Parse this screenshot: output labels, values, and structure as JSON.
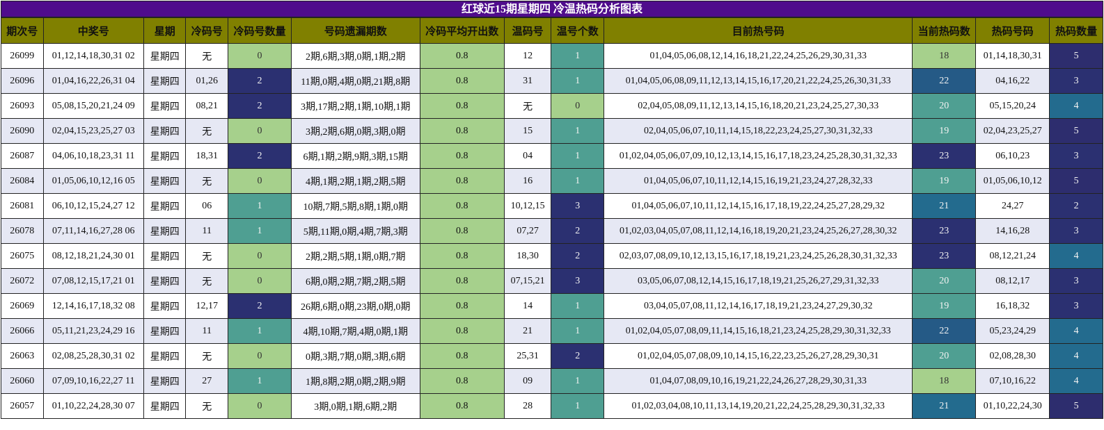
{
  "title": "红球近15期星期四 冷温热码分析图表",
  "headers": [
    "期次号",
    "中奖号",
    "星期",
    "冷码号",
    "冷码号数量",
    "号码遗漏期数",
    "冷码平均开出数",
    "温码号",
    "温号个数",
    "目前热号码",
    "当前热码数",
    "热码号码",
    "热码数量"
  ],
  "colors": {
    "title_bg": "#4f0c8c",
    "header_bg": "#808000",
    "row_alt": "#e6e8f4",
    "scale": {
      "0": "#a6d08c",
      "1": "#4f9f92",
      "2": "#2b3071",
      "3": "#2b3071",
      "4": "#236b8e",
      "5": "#2d2d6e"
    }
  },
  "rows": [
    {
      "issue": "26099",
      "numbers": "01,12,14,18,30,31 02",
      "weekday": "星期四",
      "cold": "无",
      "cold_count": "0",
      "miss": "2期,6期,3期,0期,1期,2期",
      "cold_avg": "0.8",
      "warm": "12",
      "warm_count": "1",
      "hot": "01,04,05,06,08,12,14,16,18,21,22,24,25,26,29,30,31,33",
      "hot_count": "18",
      "hot_hit": "01,14,18,30,31",
      "hot_hit_count": "5"
    },
    {
      "issue": "26096",
      "numbers": "01,04,16,22,26,31 04",
      "weekday": "星期四",
      "cold": "01,26",
      "cold_count": "2",
      "miss": "11期,0期,4期,0期,21期,8期",
      "cold_avg": "0.8",
      "warm": "31",
      "warm_count": "1",
      "hot": "01,04,05,06,08,09,11,12,13,14,15,16,17,20,21,22,24,25,26,30,31,33",
      "hot_count": "22",
      "hot_hit": "04,16,22",
      "hot_hit_count": "3"
    },
    {
      "issue": "26093",
      "numbers": "05,08,15,20,21,24 09",
      "weekday": "星期四",
      "cold": "08,21",
      "cold_count": "2",
      "miss": "3期,17期,2期,1期,10期,1期",
      "cold_avg": "0.8",
      "warm": "无",
      "warm_count": "0",
      "hot": "02,04,05,08,09,11,12,13,14,15,16,18,20,21,23,24,25,27,30,33",
      "hot_count": "20",
      "hot_hit": "05,15,20,24",
      "hot_hit_count": "4"
    },
    {
      "issue": "26090",
      "numbers": "02,04,15,23,25,27 03",
      "weekday": "星期四",
      "cold": "无",
      "cold_count": "0",
      "miss": "3期,2期,6期,0期,3期,0期",
      "cold_avg": "0.8",
      "warm": "15",
      "warm_count": "1",
      "hot": "02,04,05,06,07,10,11,14,15,18,22,23,24,25,27,30,31,32,33",
      "hot_count": "19",
      "hot_hit": "02,04,23,25,27",
      "hot_hit_count": "5"
    },
    {
      "issue": "26087",
      "numbers": "04,06,10,18,23,31 11",
      "weekday": "星期四",
      "cold": "18,31",
      "cold_count": "2",
      "miss": "6期,1期,2期,9期,3期,15期",
      "cold_avg": "0.8",
      "warm": "04",
      "warm_count": "1",
      "hot": "01,02,04,05,06,07,09,10,12,13,14,15,16,17,18,23,24,25,28,30,31,32,33",
      "hot_count": "23",
      "hot_hit": "06,10,23",
      "hot_hit_count": "3"
    },
    {
      "issue": "26084",
      "numbers": "01,05,06,10,12,16 05",
      "weekday": "星期四",
      "cold": "无",
      "cold_count": "0",
      "miss": "4期,1期,2期,1期,2期,5期",
      "cold_avg": "0.8",
      "warm": "16",
      "warm_count": "1",
      "hot": "01,04,05,06,07,10,11,12,14,15,16,19,21,23,24,27,28,32,33",
      "hot_count": "19",
      "hot_hit": "01,05,06,10,12",
      "hot_hit_count": "5"
    },
    {
      "issue": "26081",
      "numbers": "06,10,12,15,24,27 12",
      "weekday": "星期四",
      "cold": "06",
      "cold_count": "1",
      "miss": "10期,7期,5期,8期,1期,0期",
      "cold_avg": "0.8",
      "warm": "10,12,15",
      "warm_count": "3",
      "hot": "01,04,05,06,07,10,11,12,14,15,16,17,18,19,22,24,25,27,28,29,32",
      "hot_count": "21",
      "hot_hit": "24,27",
      "hot_hit_count": "2"
    },
    {
      "issue": "26078",
      "numbers": "07,11,14,16,27,28 06",
      "weekday": "星期四",
      "cold": "11",
      "cold_count": "1",
      "miss": "5期,11期,0期,4期,7期,3期",
      "cold_avg": "0.8",
      "warm": "07,27",
      "warm_count": "2",
      "hot": "01,02,03,04,05,07,08,11,12,14,16,18,19,20,21,23,24,25,26,27,28,30,32",
      "hot_count": "23",
      "hot_hit": "14,16,28",
      "hot_hit_count": "3"
    },
    {
      "issue": "26075",
      "numbers": "08,12,18,21,24,30 01",
      "weekday": "星期四",
      "cold": "无",
      "cold_count": "0",
      "miss": "2期,2期,5期,1期,0期,7期",
      "cold_avg": "0.8",
      "warm": "18,30",
      "warm_count": "2",
      "hot": "02,03,07,08,09,10,12,13,15,16,17,18,19,21,23,24,25,26,28,30,31,32,33",
      "hot_count": "23",
      "hot_hit": "08,12,21,24",
      "hot_hit_count": "4"
    },
    {
      "issue": "26072",
      "numbers": "07,08,12,15,17,21 01",
      "weekday": "星期四",
      "cold": "无",
      "cold_count": "0",
      "miss": "6期,0期,2期,7期,2期,5期",
      "cold_avg": "0.8",
      "warm": "07,15,21",
      "warm_count": "3",
      "hot": "03,05,06,07,08,12,14,15,16,17,18,19,21,25,26,27,29,31,32,33",
      "hot_count": "20",
      "hot_hit": "08,12,17",
      "hot_hit_count": "3"
    },
    {
      "issue": "26069",
      "numbers": "12,14,16,17,18,32 08",
      "weekday": "星期四",
      "cold": "12,17",
      "cold_count": "2",
      "miss": "26期,6期,0期,23期,0期,0期",
      "cold_avg": "0.8",
      "warm": "14",
      "warm_count": "1",
      "hot": "03,04,05,07,08,11,12,14,16,17,18,19,21,23,24,27,29,30,32",
      "hot_count": "19",
      "hot_hit": "16,18,32",
      "hot_hit_count": "3"
    },
    {
      "issue": "26066",
      "numbers": "05,11,21,23,24,29 16",
      "weekday": "星期四",
      "cold": "11",
      "cold_count": "1",
      "miss": "4期,10期,7期,4期,0期,1期",
      "cold_avg": "0.8",
      "warm": "21",
      "warm_count": "1",
      "hot": "01,02,04,05,07,08,09,11,14,15,16,18,21,23,24,25,28,29,30,31,32,33",
      "hot_count": "22",
      "hot_hit": "05,23,24,29",
      "hot_hit_count": "4"
    },
    {
      "issue": "26063",
      "numbers": "02,08,25,28,30,31 02",
      "weekday": "星期四",
      "cold": "无",
      "cold_count": "0",
      "miss": "0期,3期,7期,0期,3期,6期",
      "cold_avg": "0.8",
      "warm": "25,31",
      "warm_count": "2",
      "hot": "01,02,04,05,07,08,09,10,14,15,16,22,23,25,26,27,28,29,30,31",
      "hot_count": "20",
      "hot_hit": "02,08,28,30",
      "hot_hit_count": "4"
    },
    {
      "issue": "26060",
      "numbers": "07,09,10,16,22,27 11",
      "weekday": "星期四",
      "cold": "27",
      "cold_count": "1",
      "miss": "1期,8期,2期,0期,2期,9期",
      "cold_avg": "0.8",
      "warm": "09",
      "warm_count": "1",
      "hot": "01,04,07,08,09,10,16,19,21,22,24,26,27,28,29,30,31,33",
      "hot_count": "18",
      "hot_hit": "07,10,16,22",
      "hot_hit_count": "4"
    },
    {
      "issue": "26057",
      "numbers": "01,10,22,24,28,30 07",
      "weekday": "星期四",
      "cold": "无",
      "cold_count": "0",
      "miss": "3期,0期,1期,6期,2期",
      "cold_avg": "0.8",
      "warm": "28",
      "warm_count": "1",
      "hot": "01,02,03,04,08,10,11,13,14,19,20,21,22,24,25,28,29,30,31,32,33",
      "hot_count": "21",
      "hot_hit": "01,10,22,24,30",
      "hot_hit_count": "5"
    }
  ]
}
